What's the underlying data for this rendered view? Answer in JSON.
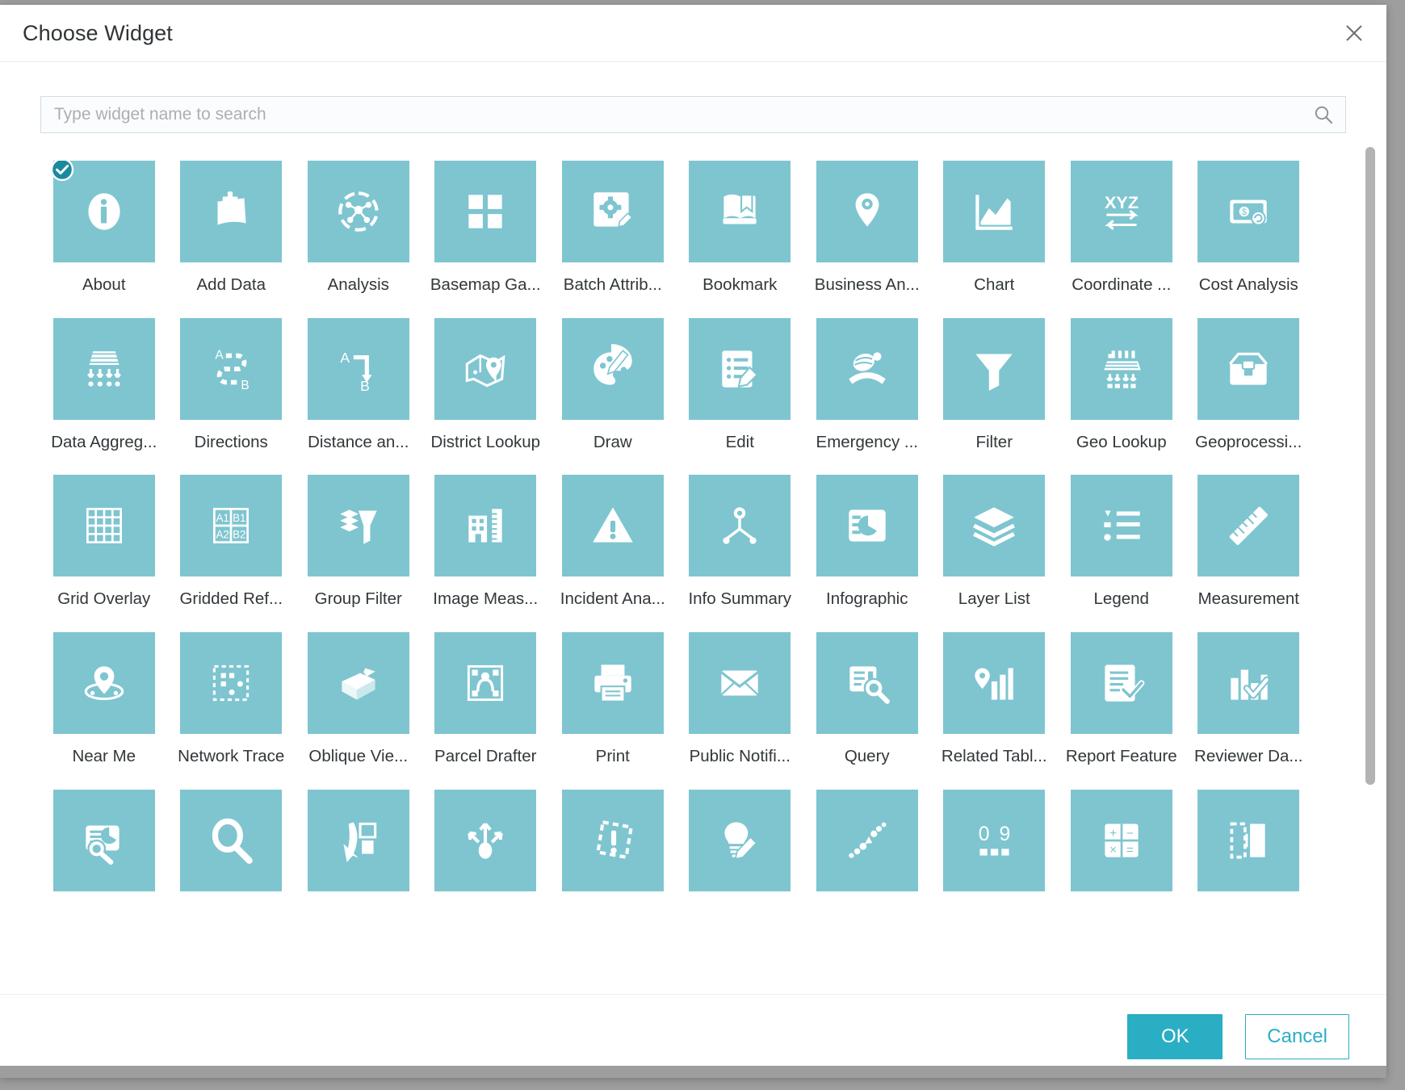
{
  "dialog": {
    "title": "Choose Widget",
    "close_icon": "close-icon"
  },
  "search": {
    "placeholder": "Type widget name to search",
    "value": "",
    "icon": "search-icon"
  },
  "footer": {
    "ok_label": "OK",
    "cancel_label": "Cancel"
  },
  "colors": {
    "tile": "#7ec5d0",
    "accent": "#2aaec4",
    "check": "#1a8a9e",
    "title_text": "#2f3437"
  },
  "selection": {
    "selected_widget": "About"
  },
  "widgets": [
    {
      "label": "About",
      "icon": "info-circle-icon",
      "selected": true
    },
    {
      "label": "Add Data",
      "icon": "add-data-icon",
      "selected": false
    },
    {
      "label": "Analysis",
      "icon": "analysis-network-icon",
      "selected": false
    },
    {
      "label": "Basemap Ga...",
      "icon": "basemap-gallery-icon",
      "selected": false
    },
    {
      "label": "Batch Attrib...",
      "icon": "batch-attribute-editor-icon",
      "selected": false
    },
    {
      "label": "Bookmark",
      "icon": "bookmark-icon",
      "selected": false
    },
    {
      "label": "Business An...",
      "icon": "business-analyst-icon",
      "selected": false
    },
    {
      "label": "Chart",
      "icon": "chart-icon",
      "selected": false
    },
    {
      "label": "Coordinate ...",
      "icon": "coordinate-conversion-icon",
      "selected": false
    },
    {
      "label": "Cost Analysis",
      "icon": "cost-analysis-icon",
      "selected": false
    },
    {
      "label": "Data Aggreg...",
      "icon": "data-aggregation-icon",
      "selected": false
    },
    {
      "label": "Directions",
      "icon": "directions-icon",
      "selected": false
    },
    {
      "label": "Distance an...",
      "icon": "distance-direction-icon",
      "selected": false
    },
    {
      "label": "District Lookup",
      "icon": "district-lookup-icon",
      "selected": false
    },
    {
      "label": "Draw",
      "icon": "draw-palette-icon",
      "selected": false
    },
    {
      "label": "Edit",
      "icon": "edit-icon",
      "selected": false
    },
    {
      "label": "Emergency ...",
      "icon": "emergency-response-icon",
      "selected": false
    },
    {
      "label": "Filter",
      "icon": "filter-funnel-icon",
      "selected": false
    },
    {
      "label": "Geo Lookup",
      "icon": "geo-lookup-icon",
      "selected": false
    },
    {
      "label": "Geoprocessi...",
      "icon": "geoprocessing-icon",
      "selected": false
    },
    {
      "label": "Grid Overlay",
      "icon": "grid-overlay-icon",
      "selected": false
    },
    {
      "label": "Gridded Ref...",
      "icon": "gridded-reference-graphic-icon",
      "selected": false
    },
    {
      "label": "Group Filter",
      "icon": "group-filter-icon",
      "selected": false
    },
    {
      "label": "Image Meas...",
      "icon": "image-measurement-icon",
      "selected": false
    },
    {
      "label": "Incident Ana...",
      "icon": "incident-analysis-icon",
      "selected": false
    },
    {
      "label": "Info Summary",
      "icon": "info-summary-icon",
      "selected": false
    },
    {
      "label": "Infographic",
      "icon": "infographic-icon",
      "selected": false
    },
    {
      "label": "Layer List",
      "icon": "layer-list-icon",
      "selected": false
    },
    {
      "label": "Legend",
      "icon": "legend-icon",
      "selected": false
    },
    {
      "label": "Measurement",
      "icon": "measurement-ruler-icon",
      "selected": false
    },
    {
      "label": "Near Me",
      "icon": "near-me-icon",
      "selected": false
    },
    {
      "label": "Network Trace",
      "icon": "network-trace-icon",
      "selected": false
    },
    {
      "label": "Oblique Vie...",
      "icon": "oblique-viewer-icon",
      "selected": false
    },
    {
      "label": "Parcel Drafter",
      "icon": "parcel-drafter-icon",
      "selected": false
    },
    {
      "label": "Print",
      "icon": "print-icon",
      "selected": false
    },
    {
      "label": "Public Notifi...",
      "icon": "public-notification-icon",
      "selected": false
    },
    {
      "label": "Query",
      "icon": "query-icon",
      "selected": false
    },
    {
      "label": "Related Tabl...",
      "icon": "related-table-chart-icon",
      "selected": false
    },
    {
      "label": "Report Feature",
      "icon": "report-feature-icon",
      "selected": false
    },
    {
      "label": "Reviewer Da...",
      "icon": "reviewer-dashboard-icon",
      "selected": false
    },
    {
      "label": "",
      "icon": "summary-report-icon",
      "selected": false
    },
    {
      "label": "",
      "icon": "search-magnifier-icon",
      "selected": false
    },
    {
      "label": "",
      "icon": "select-cursor-icon",
      "selected": false
    },
    {
      "label": "",
      "icon": "share-arrows-icon",
      "selected": false
    },
    {
      "label": "",
      "icon": "situation-awareness-icon",
      "selected": false
    },
    {
      "label": "",
      "icon": "smart-editor-icon",
      "selected": false
    },
    {
      "label": "",
      "icon": "stream-points-icon",
      "selected": false
    },
    {
      "label": "",
      "icon": "suitability-modeler-icon",
      "selected": false
    },
    {
      "label": "",
      "icon": "summary-calculator-icon",
      "selected": false
    },
    {
      "label": "",
      "icon": "swipe-icon",
      "selected": false
    }
  ]
}
